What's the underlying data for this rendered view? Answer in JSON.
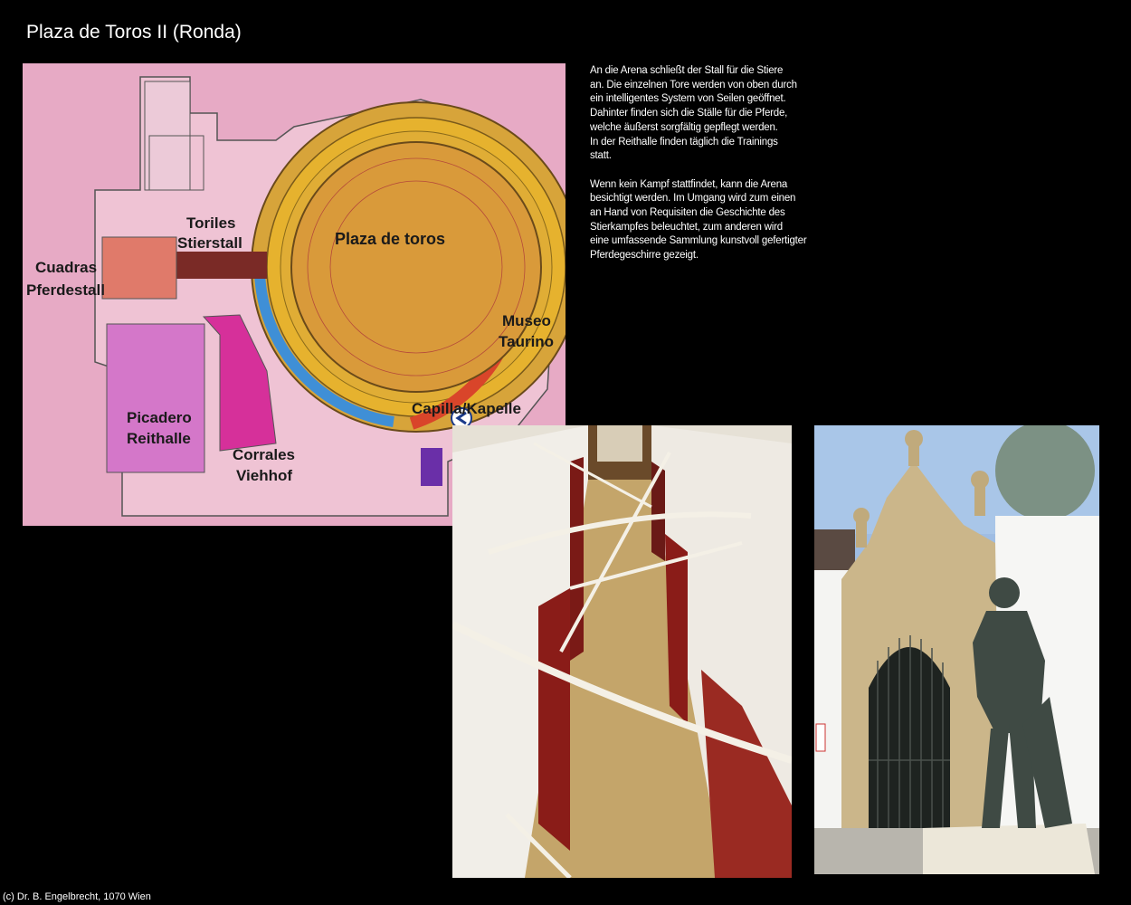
{
  "page": {
    "title": "Plaza de Toros II (Ronda)"
  },
  "description": {
    "paragraph1": "An die Arena schließt der Stall für die Stiere\nan. Die einzelnen Tore werden von oben durch\nein intelligentes System von Seilen geöffnet.\nDahinter finden sich die Ställe für die Pferde,\nwelche äußerst sorgfältig gepflegt werden.\nIn der Reithalle finden täglich die Trainings\nstatt.",
    "paragraph2": "Wenn kein Kampf stattfindet, kann die Arena\nbesichtigt werden. Im Umgang wird zum einen\nan Hand von Requisiten die Geschichte des\nStierkampfes beleuchtet, zum anderen wird\neine umfassende Sammlung kunstvoll gefertigter\nPferdegeschirre gezeigt."
  },
  "plan": {
    "labels": {
      "plaza": "Plaza de toros",
      "toriles_1": "Toriles",
      "toriles_2": "Stierstall",
      "cuadras_1": "Cuadras",
      "cuadras_2": "Pferdestall",
      "museo_1": "Museo",
      "museo_2": "Taurino",
      "capilla": "Capilla/Kapelle",
      "picadero_1": "Picadero",
      "picadero_2": "Reithalle",
      "corrales_1": "Corrales",
      "corrales_2": "Viehhof"
    },
    "colors": {
      "background": "#e7aac5",
      "arena": "#d99a3a",
      "stands": "#e6b22e",
      "museum": "#d9452a",
      "blue_corridor": "#3f8fd6",
      "stierstall": "#7a2a26",
      "pferdestall": "#e07a6a",
      "reithalle": "#d477c9",
      "viehhof": "#d6309a",
      "chapel": "#6a2fa8"
    }
  },
  "footer": {
    "copyright": "(c) Dr. B. Engelbrecht, 1070 Wien"
  }
}
